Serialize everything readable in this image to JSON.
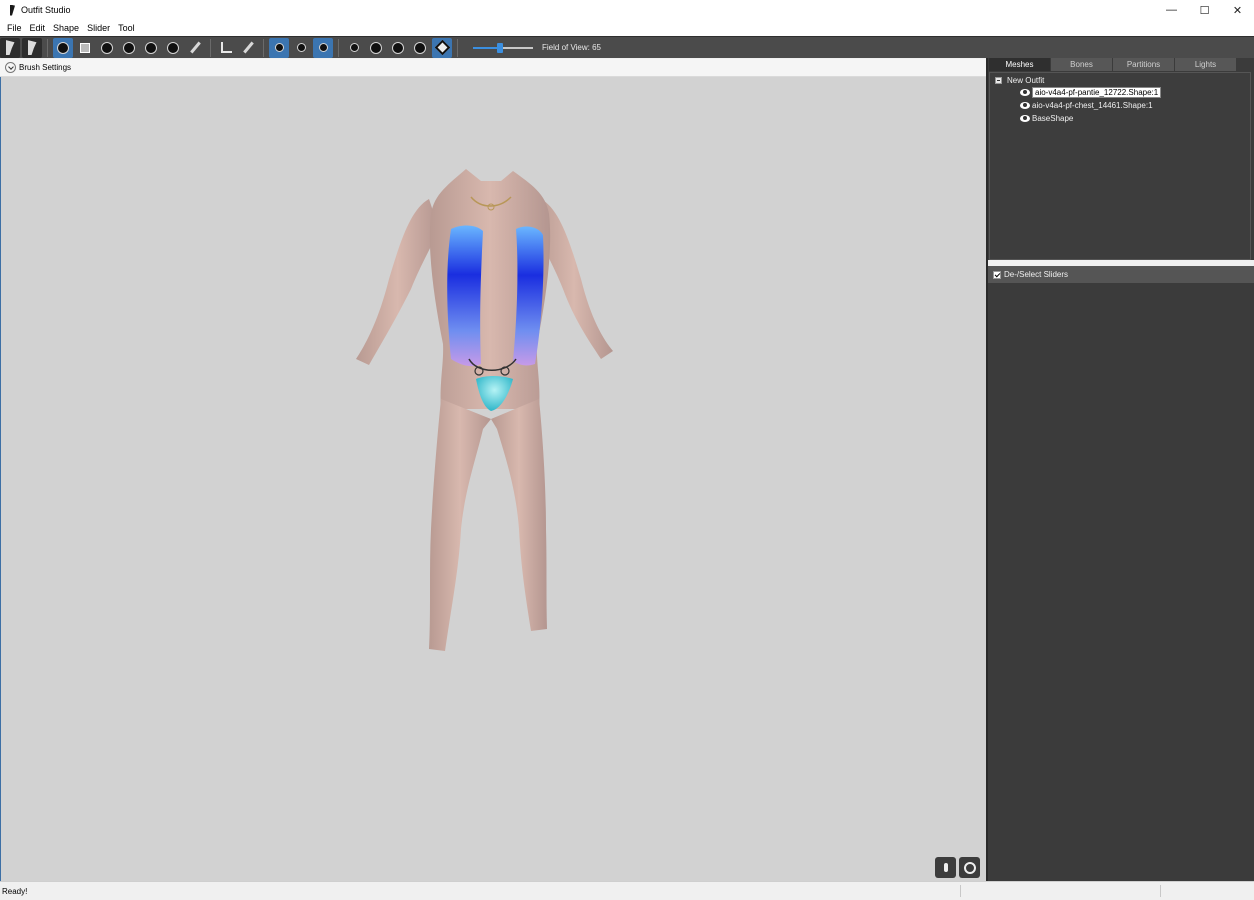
{
  "window": {
    "title": "Outfit Studio",
    "controls": [
      "—",
      "☐",
      "✕"
    ]
  },
  "menu": [
    "File",
    "Edit",
    "Shape",
    "Slider",
    "Tool"
  ],
  "toolbar": {
    "fov_label": "Field of View: 65",
    "fov_value": 65,
    "slider_fraction": 0.45,
    "accent": "#3b75b1"
  },
  "brush_settings": {
    "label": "Brush Settings"
  },
  "right_panel": {
    "tabs": [
      "Meshes",
      "Bones",
      "Partitions",
      "Lights"
    ],
    "active_tab": "Meshes",
    "tree": {
      "root": "New Outfit",
      "items": [
        {
          "label": "aio-v4a4-pf-pantie_12722.Shape:1",
          "selected": true
        },
        {
          "label": "aio-v4a4-pf-chest_14461.Shape:1",
          "selected": false
        },
        {
          "label": "BaseShape",
          "selected": false
        }
      ]
    },
    "sliders_header": "De-/Select Sliders"
  },
  "status": {
    "text": "Ready!"
  },
  "colors": {
    "viewport_bg": "#d2d2d2",
    "panel_bg": "#3b3b3b",
    "toolbar_bg": "#4b4b4b"
  }
}
